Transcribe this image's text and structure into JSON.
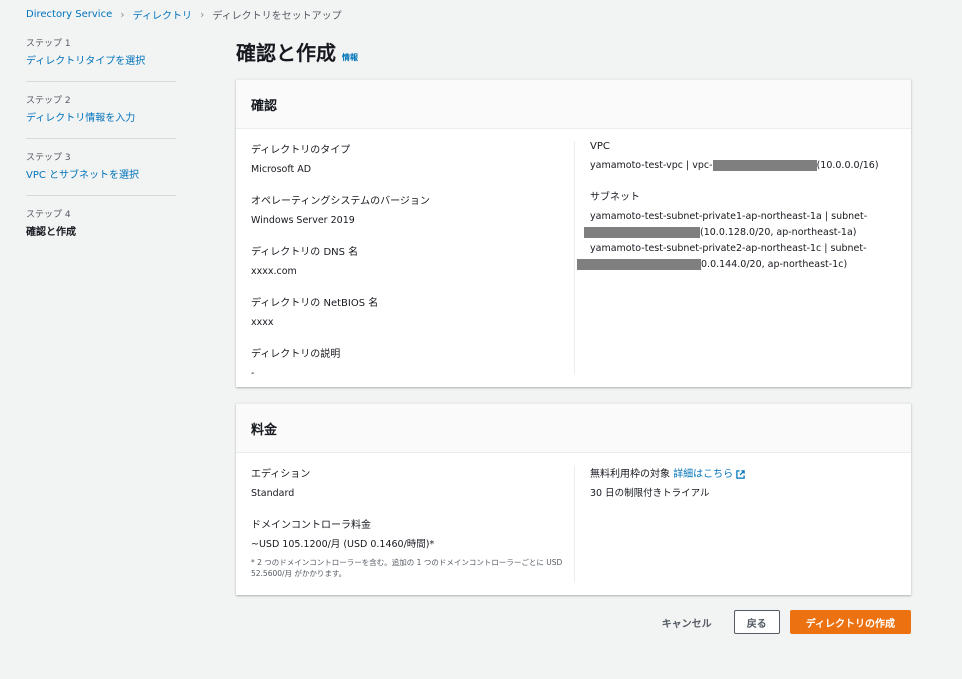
{
  "breadcrumb": {
    "items": [
      "Directory Service",
      "ディレクトリ"
    ],
    "current": "ディレクトリをセットアップ"
  },
  "steps": [
    {
      "num": "ステップ 1",
      "label": "ディレクトリタイプを選択"
    },
    {
      "num": "ステップ 2",
      "label": "ディレクトリ情報を入力"
    },
    {
      "num": "ステップ 3",
      "label": "VPC とサブネットを選択"
    },
    {
      "num": "ステップ 4",
      "label": "確認と作成"
    }
  ],
  "page": {
    "title": "確認と作成",
    "info": "情報"
  },
  "review": {
    "header": "確認",
    "dir_type_label": "ディレクトリのタイプ",
    "dir_type_value": "Microsoft AD",
    "os_label": "オペレーティングシステムのバージョン",
    "os_value": "Windows Server 2019",
    "dns_label": "ディレクトリの DNS 名",
    "dns_value": "xxxx.com",
    "netbios_label": "ディレクトリの NetBIOS 名",
    "netbios_value": "xxxx",
    "desc_label": "ディレクトリの説明",
    "desc_value": "-",
    "vpc_label": "VPC",
    "vpc_prefix": "yamamoto-test-vpc | vpc-",
    "vpc_suffix": "(10.0.0.0/16)",
    "subnet_label": "サブネット",
    "subnet1_line1": "yamamoto-test-subnet-private1-ap-northeast-1a | subnet-",
    "subnet1_line2": "(10.0.128.0/20, ap-northeast-1a)",
    "subnet2_line1": "yamamoto-test-subnet-private2-ap-northeast-1c | subnet-",
    "subnet2_line2": "0.0.144.0/20, ap-northeast-1c)"
  },
  "pricing": {
    "header": "料金",
    "edition_label": "エディション",
    "edition_value": "Standard",
    "dc_label": "ドメインコントローラ料金",
    "dc_value": "~USD 105.1200/月 (USD 0.1460/時間)*",
    "dc_note": "* 2 つのドメインコントローラーを含む。追加の 1 つのドメインコントローラーごとに USD 52.5600/月 がかかります。",
    "free_label": "無料利用枠の対象",
    "free_link": "詳細はこちら",
    "free_value": "30 日の制限付きトライアル"
  },
  "actions": {
    "cancel": "キャンセル",
    "back": "戻る",
    "create": "ディレクトリの作成"
  },
  "colors": {
    "primary": "#ec7211",
    "link": "#0073bb",
    "redaction": "#7f7f7f"
  }
}
